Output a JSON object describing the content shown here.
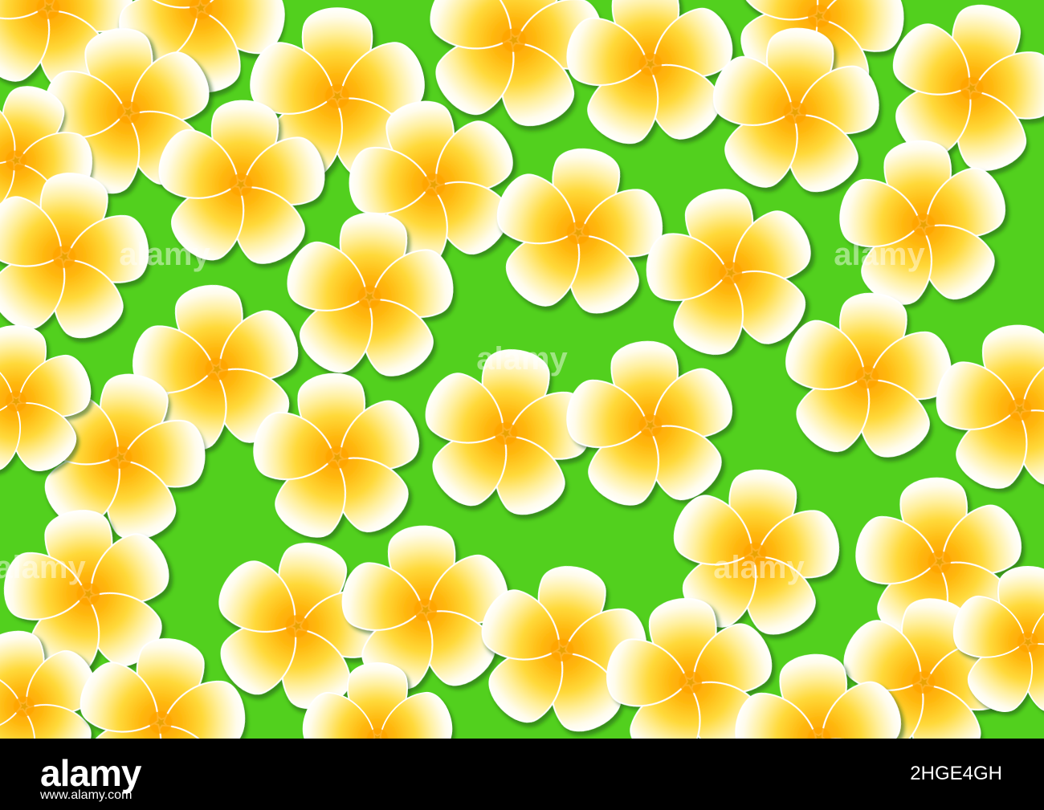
{
  "scene": {
    "description_colors": {
      "background": "#52D01E",
      "petal_edge": "#FFFFFF",
      "petal_mid": "#FFE45A",
      "center": "#FFA800"
    },
    "subject_icon": "frangipani-flower-icon"
  },
  "watermark": {
    "text": "alamy"
  },
  "footer": {
    "logo_text": "alamy",
    "image_id": "2HGE4GH",
    "url": "www.alamy.com"
  }
}
